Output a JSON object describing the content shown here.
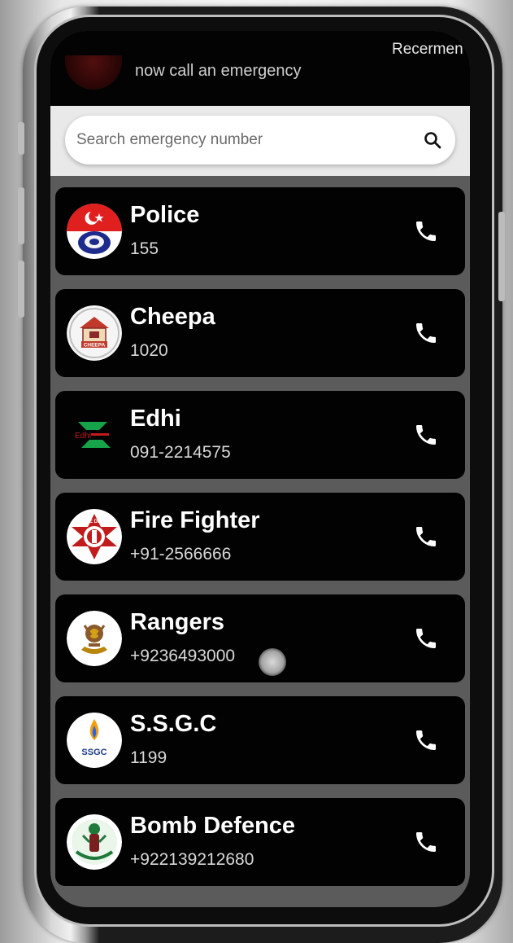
{
  "header": {
    "subtitle": "now call an emergency",
    "marquee": "Recermen"
  },
  "search": {
    "placeholder": "Search emergency number",
    "icon": "search-icon"
  },
  "contacts": [
    {
      "name": "Police",
      "number": "155",
      "logo": "police-logo",
      "call_icon": "phone-icon"
    },
    {
      "name": "Cheepa",
      "number": "1020",
      "logo": "cheepa-logo",
      "call_icon": "phone-icon"
    },
    {
      "name": "Edhi",
      "number": "091-2214575",
      "logo": "edhi-logo",
      "call_icon": "phone-icon"
    },
    {
      "name": "Fire Fighter",
      "number": "+91-2566666",
      "logo": "fire-dept-logo",
      "call_icon": "phone-icon"
    },
    {
      "name": "Rangers",
      "number": "+9236493000",
      "logo": "rangers-logo",
      "call_icon": "phone-icon"
    },
    {
      "name": "S.S.G.C",
      "number": "1199",
      "logo": "ssgc-logo",
      "call_icon": "phone-icon"
    },
    {
      "name": "Bomb Defence",
      "number": "+922139212680",
      "logo": "bomb-defence-logo",
      "call_icon": "phone-icon"
    }
  ],
  "logo_text": {
    "cheepa": "CHEEPA",
    "edhi": "Edhi",
    "fire": "FIRE DEPT",
    "ssgc": "SSGC"
  },
  "colors": {
    "card_bg": "#020202",
    "screen_bg": "#5b5b5b",
    "police_red": "#e0201f",
    "police_blue": "#1d2c8c",
    "edhi_green": "#16a34a",
    "fire_red": "#c21b1b",
    "ssgc_blue": "#1e3a8a"
  }
}
